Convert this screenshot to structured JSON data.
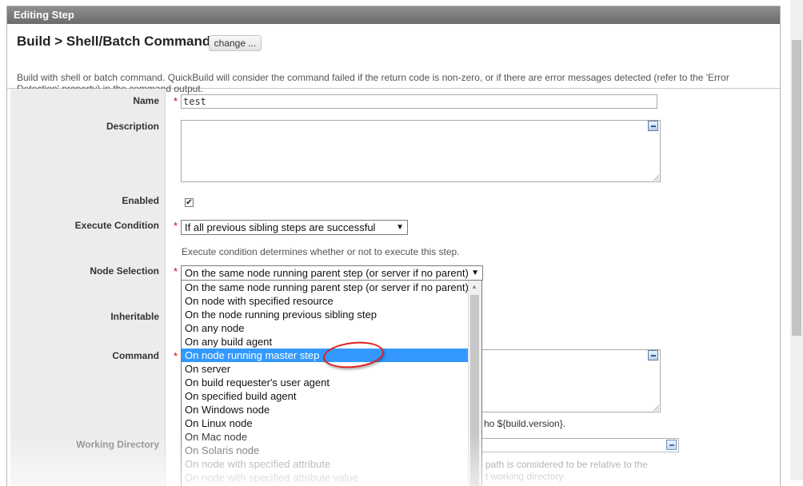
{
  "window": {
    "title": "Editing Step"
  },
  "header": {
    "title": "Build > Shell/Batch Command",
    "change_label": "change ...",
    "description": "Build with shell or batch command. QuickBuild will consider the command failed if the return code is non-zero, or if there are error messages detected (refer to the 'Error Detection' property) in the command output."
  },
  "form": {
    "name_label": "Name",
    "name_value": "test",
    "description_label": "Description",
    "enabled_label": "Enabled",
    "enabled_check": "✔",
    "exec_label": "Execute Condition",
    "exec_value": "If all previous sibling steps are successful",
    "exec_help": "Execute condition determines whether or not to execute this step.",
    "node_label": "Node Selection",
    "node_value": "On the same node running parent step (or server if no parent)",
    "inheritable_label": "Inheritable",
    "command_label": "Command",
    "command_help_tail": "ho ${build.version}.",
    "workdir_label": "Working Directory",
    "workdir_help_line1": "path is considered to be relative to the",
    "workdir_help_line2": "t working directory",
    "required_mark": "*"
  },
  "dropdown": {
    "options": [
      "On the same node running parent step (or server if no parent)",
      "On node with specified resource",
      "On the node running previous sibling step",
      "On any node",
      "On any build agent",
      "On node running master step",
      "On server",
      "On build requester's user agent",
      "On specified build agent",
      "On Windows node",
      "On Linux node",
      "On Mac node",
      "On Solaris node",
      "On node with specified attribute",
      "On node with specified attribute value"
    ],
    "selected_index": 5
  },
  "colors": {
    "selected_option_bg": "#3399ff",
    "title_bar": "#7a7a7a",
    "required": "#cc0000",
    "annotation": "#e02020"
  }
}
